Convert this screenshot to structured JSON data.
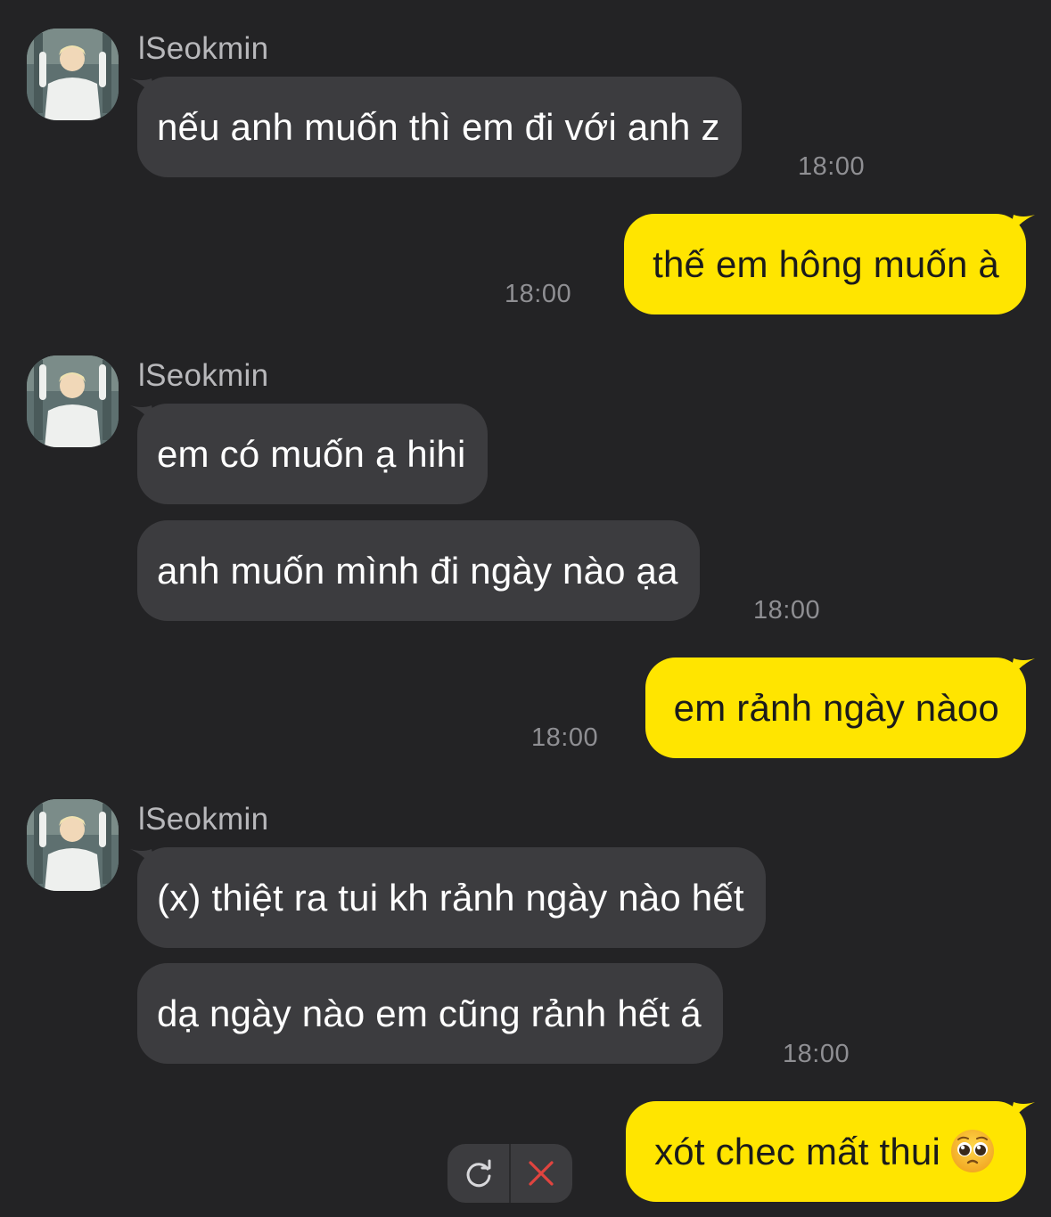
{
  "colors": {
    "background": "#232325",
    "incoming_bubble": "#3c3c3f",
    "outgoing_bubble": "#ffe500",
    "timestamp": "#8f8f93",
    "sender_name": "#b8b8bb",
    "cancel_red": "#e0443f"
  },
  "messages": [
    {
      "direction": "in",
      "sender": "lSeokmin",
      "text": "nếu anh muốn thì em đi với anh z",
      "time": "18:00"
    },
    {
      "direction": "out",
      "text": "thế em hông muốn à",
      "time": "18:00"
    },
    {
      "direction": "in",
      "sender": "lSeokmin",
      "text": "em có muốn ạ hihi"
    },
    {
      "direction": "in",
      "text": "anh muốn mình đi ngày nào ạa",
      "time": "18:00"
    },
    {
      "direction": "out",
      "text": "em rảnh ngày nàoo",
      "time": "18:00"
    },
    {
      "direction": "in",
      "sender": "lSeokmin",
      "text": "(x) thiệt ra tui kh rảnh ngày nào hết"
    },
    {
      "direction": "in",
      "text": "dạ ngày nào em cũng rảnh hết á",
      "time": "18:00"
    },
    {
      "direction": "out",
      "text": "xót chec mất thui",
      "emoji": "pleading-face-icon",
      "status": "failed"
    }
  ],
  "failed_actions": {
    "retry_icon": "retry-icon",
    "cancel_icon": "close-icon"
  }
}
